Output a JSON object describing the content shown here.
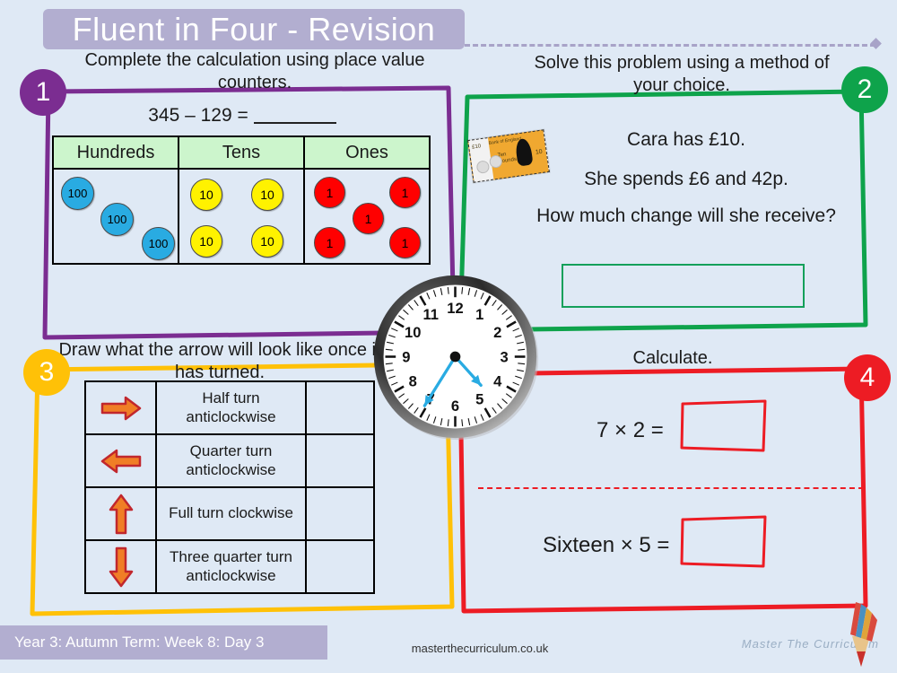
{
  "header": {
    "title": "Fluent in Four - Revision"
  },
  "questions": [
    {
      "number": "1",
      "color": "#7B2D91",
      "prompt": "Complete the calculation using place value counters.",
      "equation": {
        "expression": "345 – 129 =",
        "answer": ""
      },
      "place_value_table": {
        "headers": [
          "Hundreds",
          "Tens",
          "Ones"
        ],
        "counters": {
          "hundreds": [
            "100",
            "100",
            "100"
          ],
          "tens": [
            "10",
            "10",
            "10",
            "10"
          ],
          "ones": [
            "1",
            "1",
            "1",
            "1",
            "1"
          ]
        },
        "header_fill": "#ccf5cc",
        "hundreds_color": "#29ABE2",
        "tens_color": "#FFF200",
        "ones_color": "#FF0000"
      }
    },
    {
      "number": "2",
      "color": "#0EA34B",
      "prompt": "Solve this problem using a method of your choice.",
      "word_problem": {
        "line1": "Cara has £10.",
        "line2": "She spends £6 and 42p.",
        "line3": "How much change will she receive?"
      },
      "banknote": {
        "left_value": "£10",
        "right_value": "10",
        "bank_label": "Bank of England",
        "promise": "Ten\nPounds"
      },
      "answer_box": ""
    },
    {
      "number": "3",
      "color": "#FFC107",
      "prompt": "Draw what the arrow will look like once it has turned.",
      "turn_table": {
        "rows": [
          {
            "arrow": "arrow-right-icon",
            "label": "Half turn anticlockwise",
            "answer": ""
          },
          {
            "arrow": "arrow-left-icon",
            "label": "Quarter turn anticlockwise",
            "answer": ""
          },
          {
            "arrow": "arrow-up-icon",
            "label": "Full turn clockwise",
            "answer": ""
          },
          {
            "arrow": "arrow-down-icon",
            "label": "Three quarter turn anticlockwise",
            "answer": ""
          }
        ],
        "arrow_fill": "#F07E26",
        "arrow_stroke": "#C1272D"
      }
    },
    {
      "number": "4",
      "color": "#ED1C24",
      "prompt": "Calculate.",
      "calculations": [
        {
          "expression": "7 × 2 =",
          "answer": ""
        },
        {
          "expression": "Sixteen × 5 =",
          "answer": ""
        }
      ]
    }
  ],
  "clock": {
    "numerals": [
      "12",
      "1",
      "2",
      "3",
      "4",
      "5",
      "6",
      "7",
      "8",
      "9",
      "10",
      "11"
    ],
    "hour_hand_angle": 138,
    "minute_hand_angle": 212,
    "hand_color": "#29ABE2"
  },
  "footer": {
    "lesson_label": "Year 3: Autumn Term: Week 8: Day 3",
    "website": "masterthecurriculum.co.uk",
    "brand": "Master The Curriculum"
  }
}
